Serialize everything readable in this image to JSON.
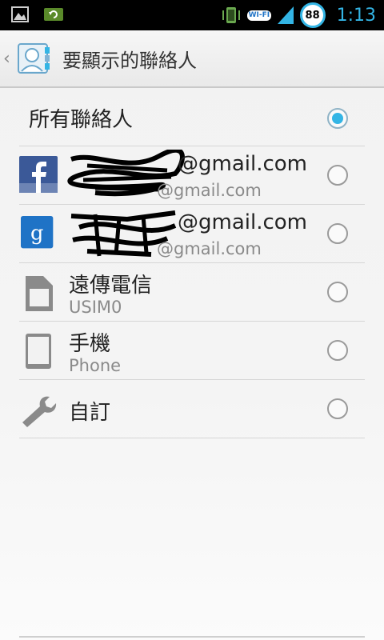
{
  "status_bar": {
    "time": "1:13",
    "battery_level": "88",
    "wifi_label": "WI-FI",
    "icons": [
      "gallery-icon",
      "sync-icon",
      "vibrate-icon",
      "wifi-icon",
      "signal-icon"
    ]
  },
  "action_bar": {
    "title": "要顯示的聯絡人",
    "app_icon": "contacts-icon"
  },
  "list": {
    "all_contacts": {
      "label": "所有聯絡人",
      "selected": true
    },
    "items": [
      {
        "icon": "facebook-icon",
        "title": "@gmail.com",
        "subtitle": "@gmail.com",
        "selected": false
      },
      {
        "icon": "google-icon",
        "title": "@gmail.com",
        "subtitle": "@gmail.com",
        "selected": false
      },
      {
        "icon": "sim-card-icon",
        "title": "遠傳電信",
        "subtitle": "USIM0",
        "selected": false
      },
      {
        "icon": "phone-icon",
        "title": "手機",
        "subtitle": "Phone",
        "selected": false
      },
      {
        "icon": "wrench-icon",
        "title": "自訂",
        "subtitle": "",
        "selected": false
      }
    ]
  },
  "colors": {
    "accent": "#33b5e5",
    "facebook": "#3b5998",
    "google": "#1f73c6",
    "status_bg": "#000000"
  }
}
